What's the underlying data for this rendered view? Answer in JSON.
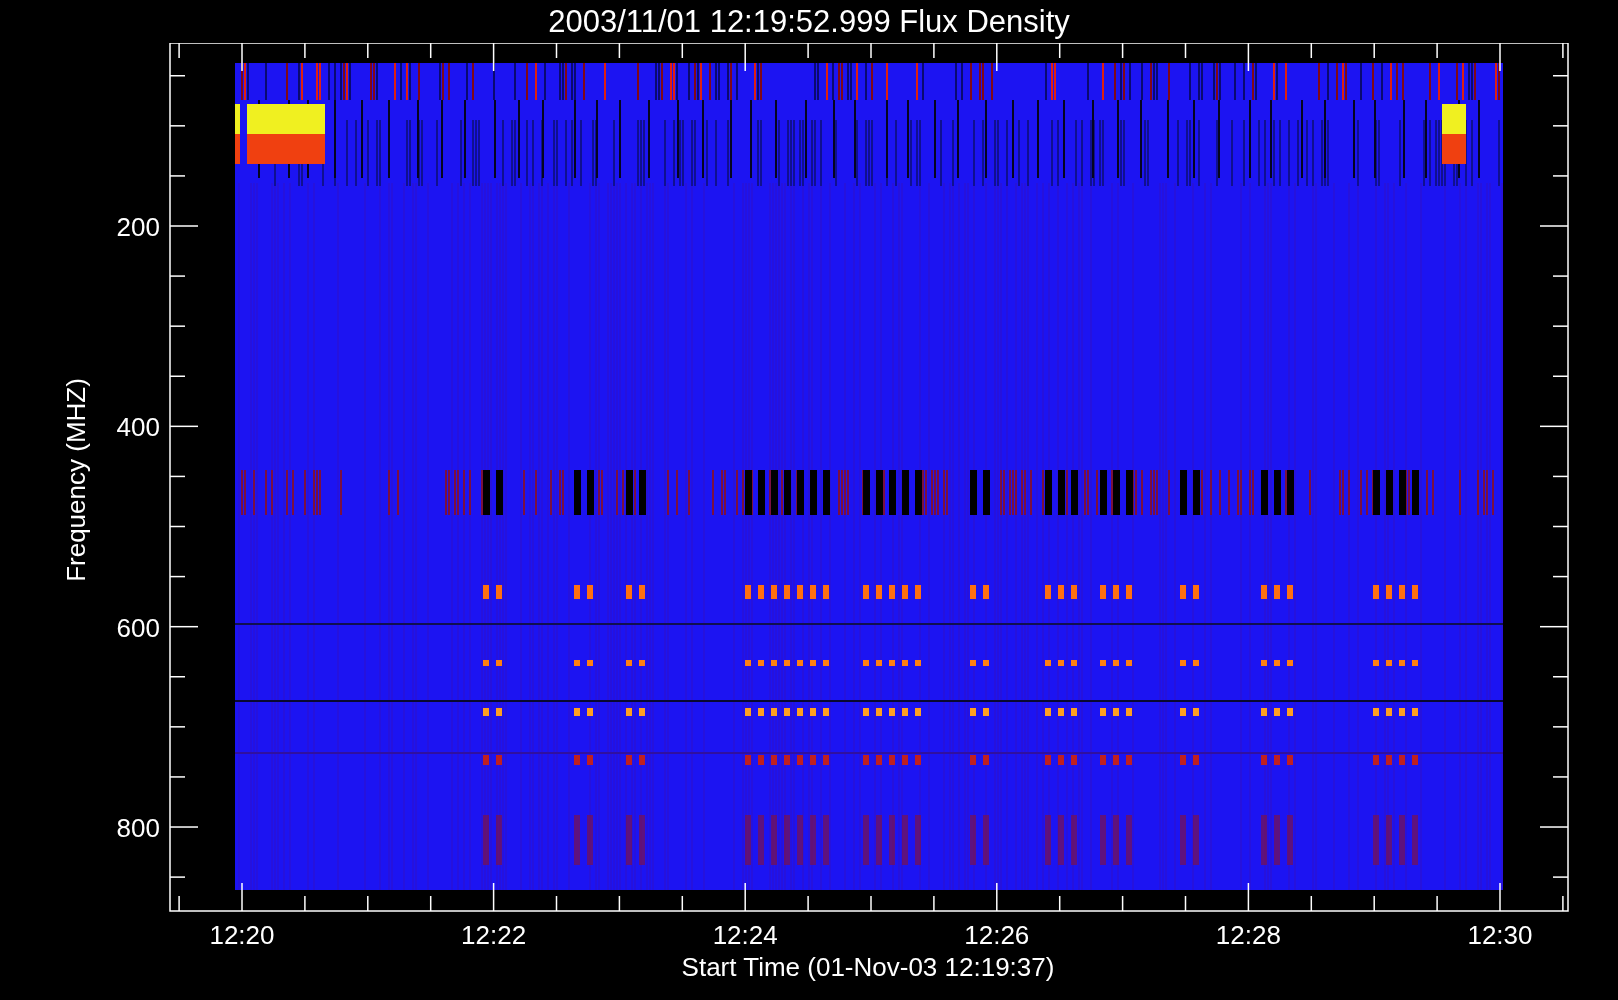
{
  "title": "2003/11/01 12:19:52.999 Flux Density",
  "y_axis": {
    "label": "Frequency (MHZ)",
    "ticks": [
      "200",
      "400",
      "600",
      "800"
    ]
  },
  "x_axis": {
    "label": "Start Time (01-Nov-03 12:19:37)",
    "ticks": [
      "12:20",
      "12:22",
      "12:24",
      "12:26",
      "12:28",
      "12:30"
    ]
  }
}
